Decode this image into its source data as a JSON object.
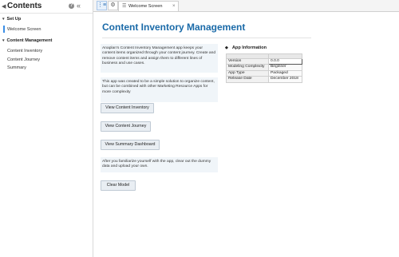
{
  "sidebar": {
    "title": "Contents",
    "sections": [
      {
        "label": "Set Up",
        "items": [
          "Welcome Screen"
        ]
      },
      {
        "label": "Content Management",
        "items": [
          "Content Inventory",
          "Content Journey",
          "Summary"
        ]
      }
    ]
  },
  "tabbar": {
    "active_tab": "Welcome Screen",
    "close": "×"
  },
  "main": {
    "title": "Content Inventory Management",
    "intro_text": "Anaplan's Content Inventory Management app keeps your content items organized through your content journey. Create and remove content items and assign them to different lines of business and use cases.",
    "intro_text2": "This app was created to be a simple solution to organize content, but can be combined with other Marketing Resource Apps for more complexity",
    "buttons": {
      "view_inventory": "View Content Inventory",
      "view_journey": "View Content Journey",
      "view_summary": "View Summary Dashboard",
      "clear_model": "Clear Model"
    },
    "familiarize_note": "After you familiarize yourself with the app, clear out the dummy data and upload your own."
  },
  "app_info": {
    "title": "App Information",
    "rows": [
      {
        "key": "Version",
        "value": "0.0.0"
      },
      {
        "key": "Modeling Complexity",
        "value": "Beginner"
      },
      {
        "key": "App Type",
        "value": "Packaged"
      },
      {
        "key": "Release Date",
        "value": "December 2018"
      }
    ]
  },
  "colors": {
    "title_blue": "#1a6aa8",
    "active_indicator": "#3b8ee6",
    "panel_bg": "#f0f5f9"
  }
}
